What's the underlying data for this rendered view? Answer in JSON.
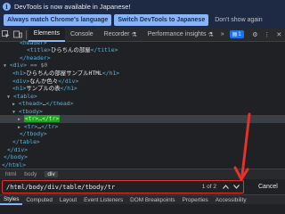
{
  "notice": {
    "text": "DevTools is now available in Japanese!",
    "icon": "info-icon"
  },
  "language_bar": {
    "match_button": "Always match Chrome's language",
    "switch_button": "Switch DevTools to Japanese",
    "dismiss_link": "Don't show again"
  },
  "toolbar": {
    "tabs": [
      "Elements",
      "Console",
      "Recorder",
      "Performance insights"
    ],
    "active_tab": "Elements",
    "recorder_icon": "flask-icon",
    "perf_icon": "flask-icon",
    "issues_count": "1"
  },
  "tree": {
    "l1_open": "<header>",
    "l2_title_open": "<title>",
    "l2_title_text": "ひらちんの部屋",
    "l2_title_close": "</title>",
    "l3_header_close": "</header>",
    "l4_div_open": "<div>",
    "l4_marker": "== $0",
    "l5_h1_open": "<h1>",
    "l5_h1_text": "ひらちんの部屋サンプルHTML",
    "l5_h1_close": "</h1>",
    "l6_div_open": "<div>",
    "l6_div_text": "なんか色々",
    "l6_div_close": "</div>",
    "l7_h1_open": "<h1>",
    "l7_h1_text": "サンプルの表",
    "l7_h1_close": "</h1>",
    "l8_table_open": "<table>",
    "l9_thead": "<thead>",
    "l9_thead_ell": "…",
    "l9_thead_close": "</thead>",
    "l10_tbody_open": "<tbody>",
    "l11_tr_sel": "<tr>…</tr>",
    "l12_tr": "<tr>",
    "l12_tr_ell": "…",
    "l12_tr_close": "</tr>",
    "l13_tbody_close": "</tbody>",
    "l14_table_close": "</table>",
    "l15_div_close": "</div>",
    "l16_body_close": "</body>",
    "l17_html_close": "</html>"
  },
  "breadcrumbs": [
    "html",
    "body",
    "div"
  ],
  "search": {
    "value": "/html/body/div/table/tbody/tr",
    "match_count": "1 of 2",
    "cancel": "Cancel"
  },
  "bottom_tabs": [
    "Styles",
    "Computed",
    "Layout",
    "Event Listeners",
    "DOM Breakpoints",
    "Properties",
    "Accessibility"
  ],
  "colors": {
    "accent": "#8ab4f8",
    "highlight_arrow": "#e8312a",
    "match_highlight": "#21a121"
  }
}
